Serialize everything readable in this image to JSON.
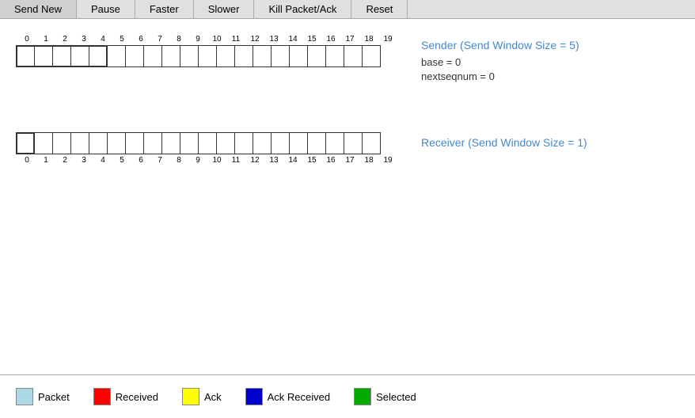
{
  "toolbar": {
    "buttons": [
      "Send New",
      "Pause",
      "Faster",
      "Slower",
      "Kill Packet/Ack",
      "Reset"
    ]
  },
  "sender": {
    "title": "Sender (Send Window Size = 5)",
    "base_label": "base = 0",
    "nextseqnum_label": "nextseqnum = 0",
    "total_packets": 20,
    "window_size": 5
  },
  "receiver": {
    "title": "Receiver (Send Window Size = 1)",
    "total_packets": 20,
    "window_size": 1
  },
  "legend": {
    "items": [
      {
        "label": "Packet",
        "color": "#add8e6"
      },
      {
        "label": "Received",
        "color": "#ff0000"
      },
      {
        "label": "Ack",
        "color": "#ffff00"
      },
      {
        "label": "Ack Received",
        "color": "#0000cc"
      },
      {
        "label": "Selected",
        "color": "#00aa00"
      }
    ]
  }
}
